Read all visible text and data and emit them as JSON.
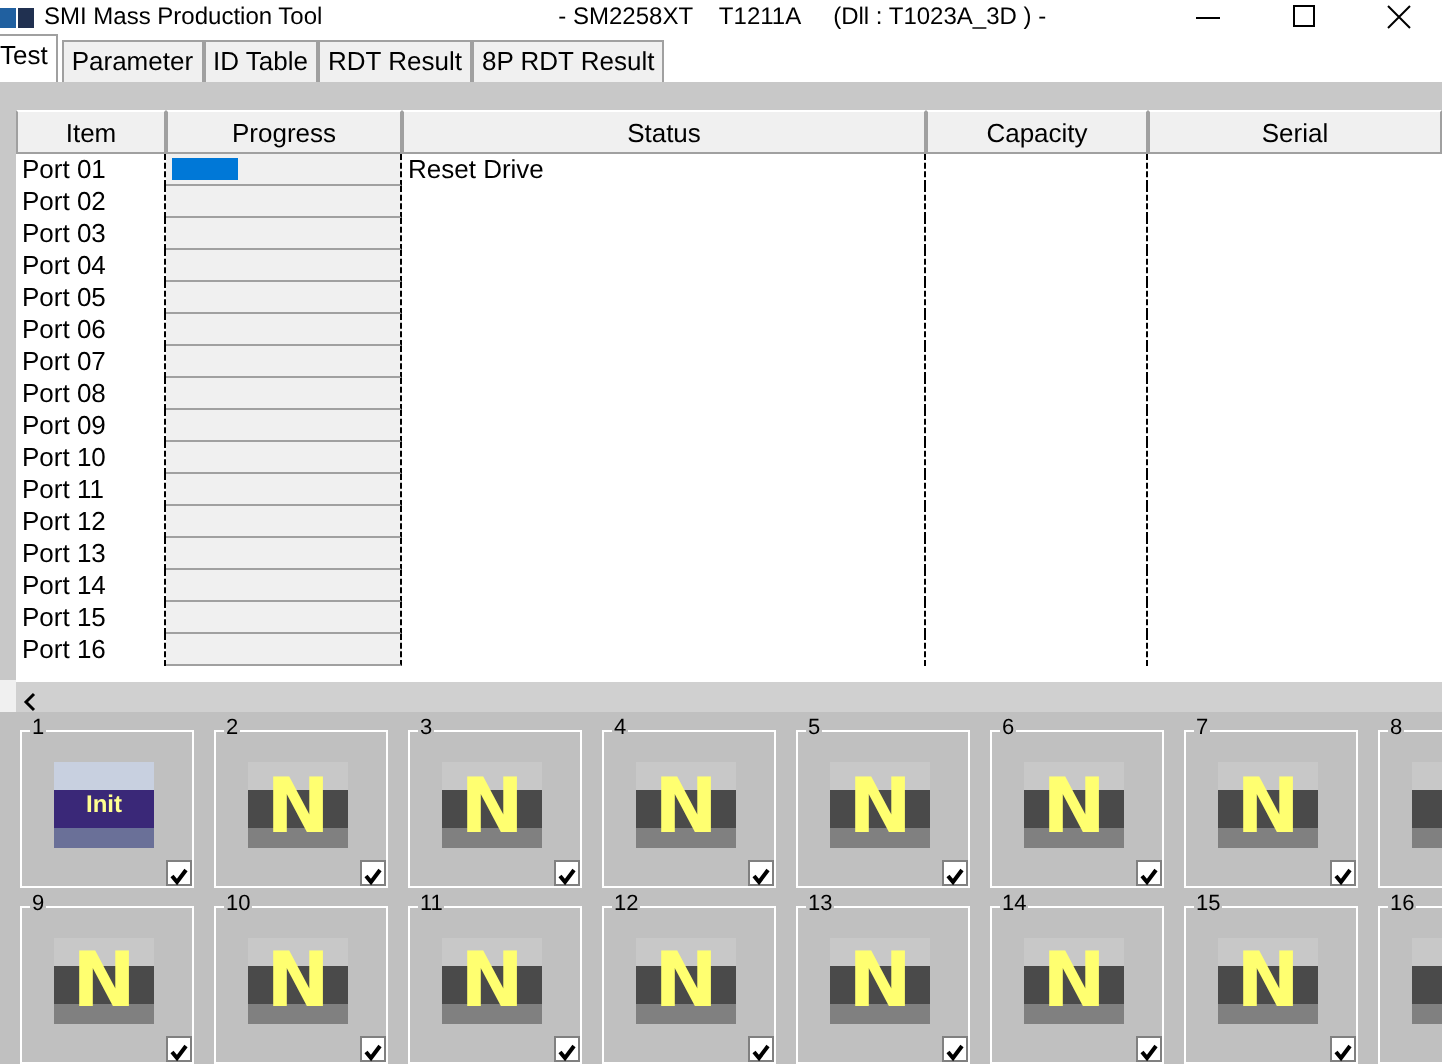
{
  "window": {
    "title": "SMI Mass Production Tool",
    "subtitle": "- SM2258XT    T1211A     (Dll : T1023A_3D ) -"
  },
  "tabs": [
    {
      "label": "Test",
      "selected": true
    },
    {
      "label": "Parameter",
      "selected": false
    },
    {
      "label": "ID Table",
      "selected": false
    },
    {
      "label": "RDT Result",
      "selected": false
    },
    {
      "label": "8P RDT Result",
      "selected": false
    }
  ],
  "table": {
    "columns": [
      "Item",
      "Progress",
      "Status",
      "Capacity",
      "Serial"
    ],
    "rows": [
      {
        "item": "Port 01",
        "level": 0.3,
        "status": "Reset Drive"
      },
      {
        "item": "Port 02"
      },
      {
        "item": "Port 03"
      },
      {
        "item": "Port 04"
      },
      {
        "item": "Port 05"
      },
      {
        "item": "Port 06"
      },
      {
        "item": "Port 07"
      },
      {
        "item": "Port 08"
      },
      {
        "item": "Port 09"
      },
      {
        "item": "Port 10"
      },
      {
        "item": "Port 11"
      },
      {
        "item": "Port 12"
      },
      {
        "item": "Port 13"
      },
      {
        "item": "Port 14"
      },
      {
        "item": "Port 15"
      },
      {
        "item": "Port 16"
      }
    ]
  },
  "ports": [
    {
      "number": "1",
      "kind": "init",
      "badge": "Init",
      "checked": true
    },
    {
      "number": "2",
      "kind": "idle",
      "badge": "N",
      "checked": true
    },
    {
      "number": "3",
      "kind": "idle",
      "badge": "N",
      "checked": true
    },
    {
      "number": "4",
      "kind": "idle",
      "badge": "N",
      "checked": true
    },
    {
      "number": "5",
      "kind": "idle",
      "badge": "N",
      "checked": true
    },
    {
      "number": "6",
      "kind": "idle",
      "badge": "N",
      "checked": true
    },
    {
      "number": "7",
      "kind": "idle",
      "badge": "N",
      "checked": true
    },
    {
      "number": "8",
      "kind": "idle"
    },
    {
      "number": "9",
      "kind": "idle",
      "badge": "N",
      "checked": true
    },
    {
      "number": "10",
      "kind": "idle",
      "badge": "N",
      "checked": true
    },
    {
      "number": "11",
      "kind": "idle",
      "badge": "N",
      "checked": true
    },
    {
      "number": "12",
      "kind": "idle",
      "badge": "N",
      "checked": true
    },
    {
      "number": "13",
      "kind": "idle",
      "badge": "N",
      "checked": true
    },
    {
      "number": "14",
      "kind": "idle",
      "badge": "N",
      "checked": true
    },
    {
      "number": "15",
      "kind": "idle",
      "badge": "N",
      "checked": true
    },
    {
      "number": "16",
      "kind": "idle"
    }
  ]
}
